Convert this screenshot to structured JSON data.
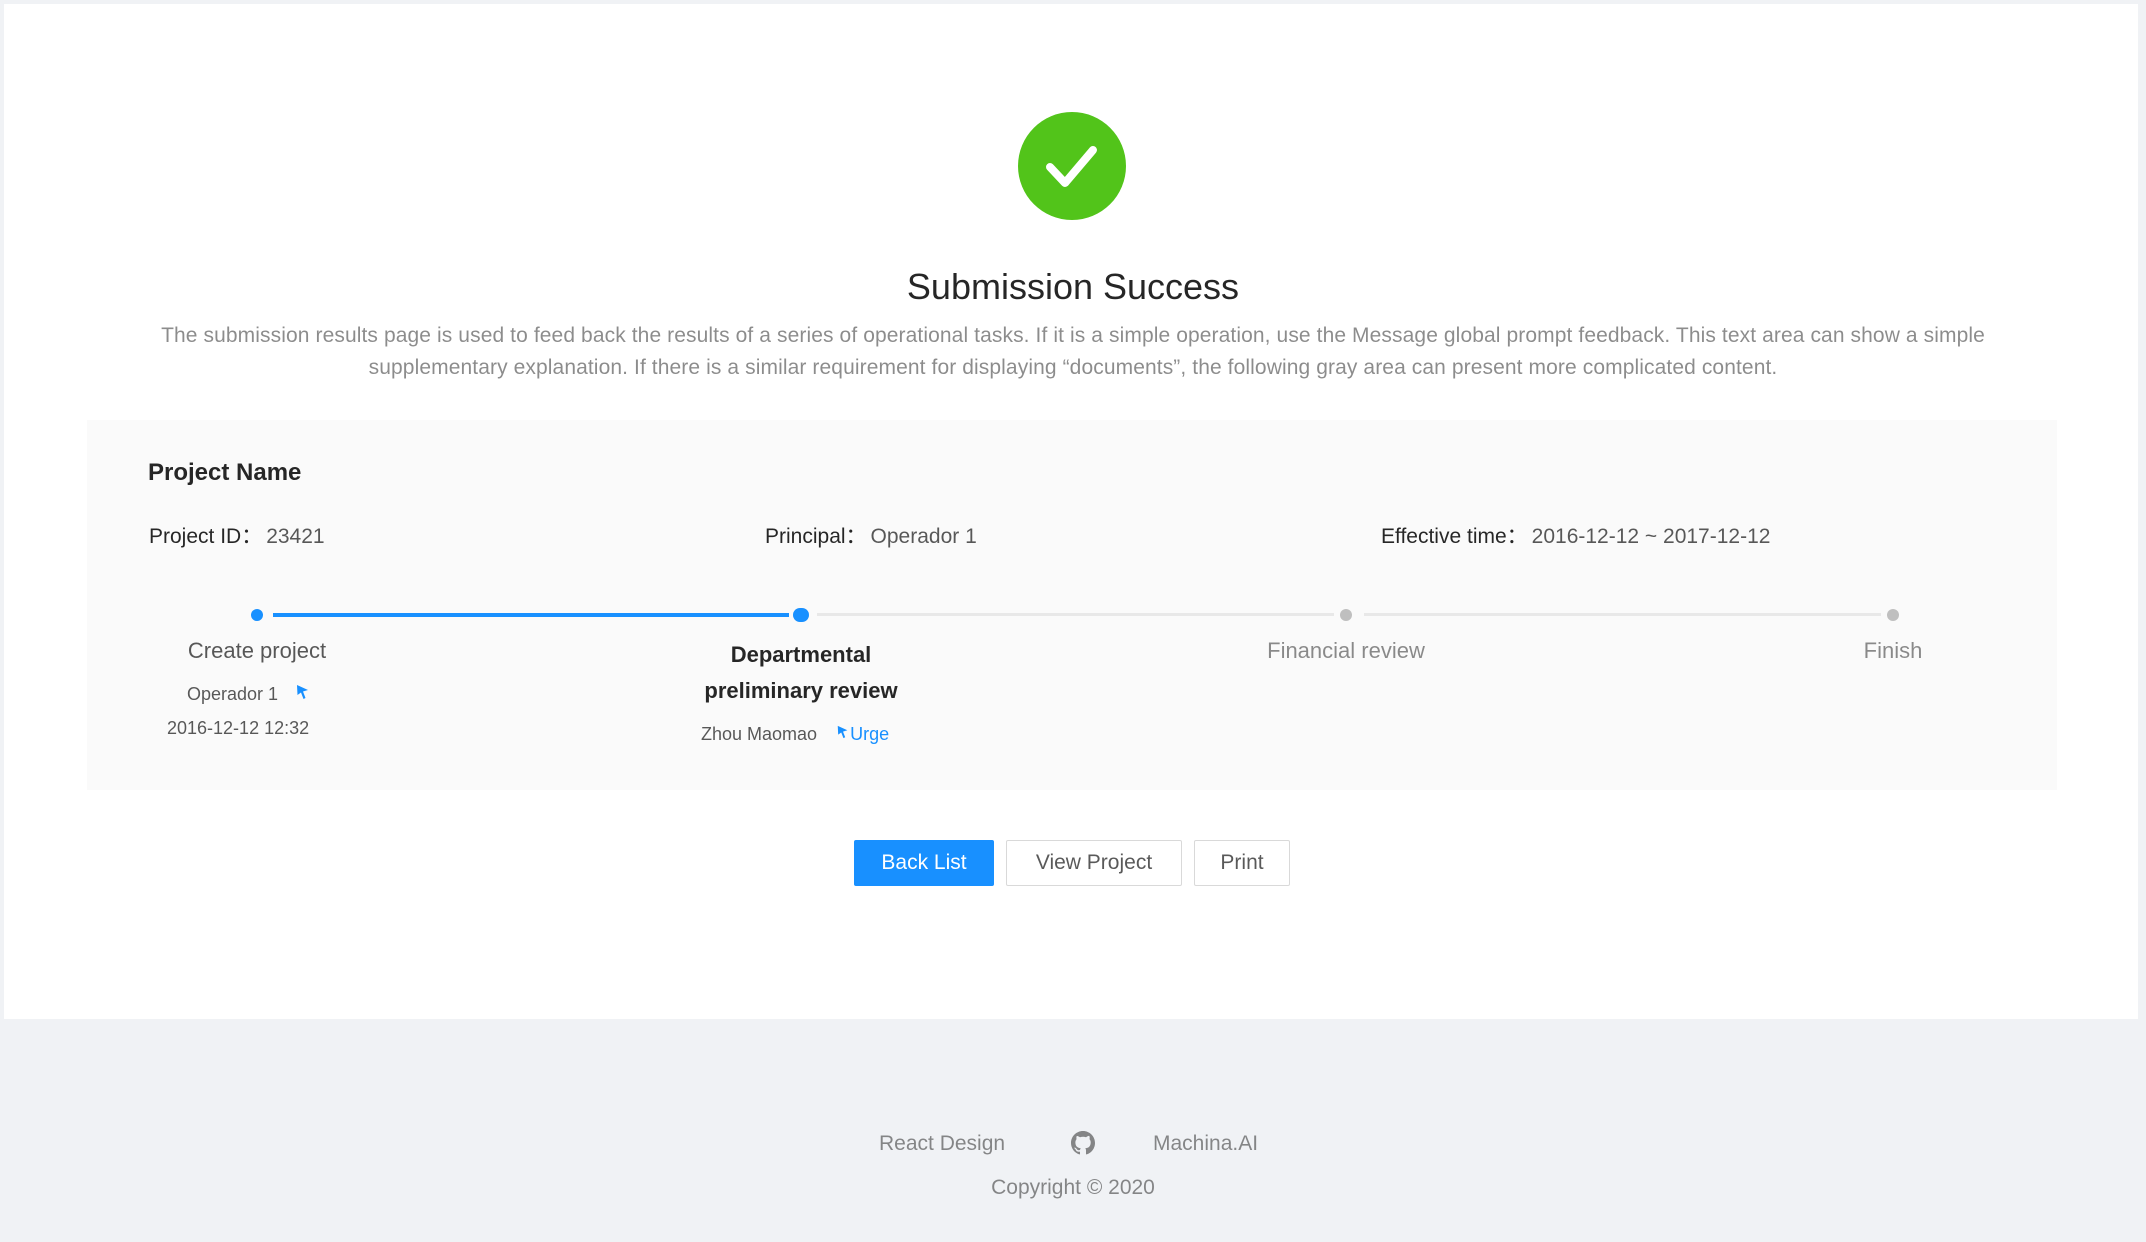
{
  "result": {
    "status": "success",
    "icon": "check-circle-icon",
    "title": "Submission Success",
    "description_line1": "The submission results page is used to feed back the results of a series of operational tasks. If it is a simple operation, use the Message global prompt feedback. This text area can show a simple",
    "description_line2": "supplementary explanation. If there is a similar requirement for displaying “documents”, the following gray area can present more complicated content."
  },
  "project": {
    "name": "Project Name",
    "id_label": "Project ID：",
    "id_value": "23421",
    "principal_label": "Principal：",
    "principal_value": "Operador 1",
    "effective_label": "Effective time：",
    "effective_value": "2016-12-12 ~ 2017-12-12"
  },
  "steps": [
    {
      "title": "Create project",
      "status": "finish",
      "person": "Operador 1",
      "time": "2016-12-12 12:32"
    },
    {
      "title_line1": "Departmental",
      "title_line2": "preliminary review",
      "status": "process",
      "person": "Zhou Maomao",
      "action": "Urge"
    },
    {
      "title": "Financial review",
      "status": "wait"
    },
    {
      "title": "Finish",
      "status": "wait"
    }
  ],
  "actions": {
    "back_list": "Back List",
    "view_project": "View Project",
    "print": "Print"
  },
  "footer": {
    "link1": "React Design",
    "link2_icon": "github-icon",
    "link3": "Machina.AI",
    "copyright": "Copyright © 2020"
  },
  "colors": {
    "success": "#52c41a",
    "primary": "#1890ff",
    "panel_bg": "#fafafa",
    "page_bg": "#f0f2f5"
  }
}
